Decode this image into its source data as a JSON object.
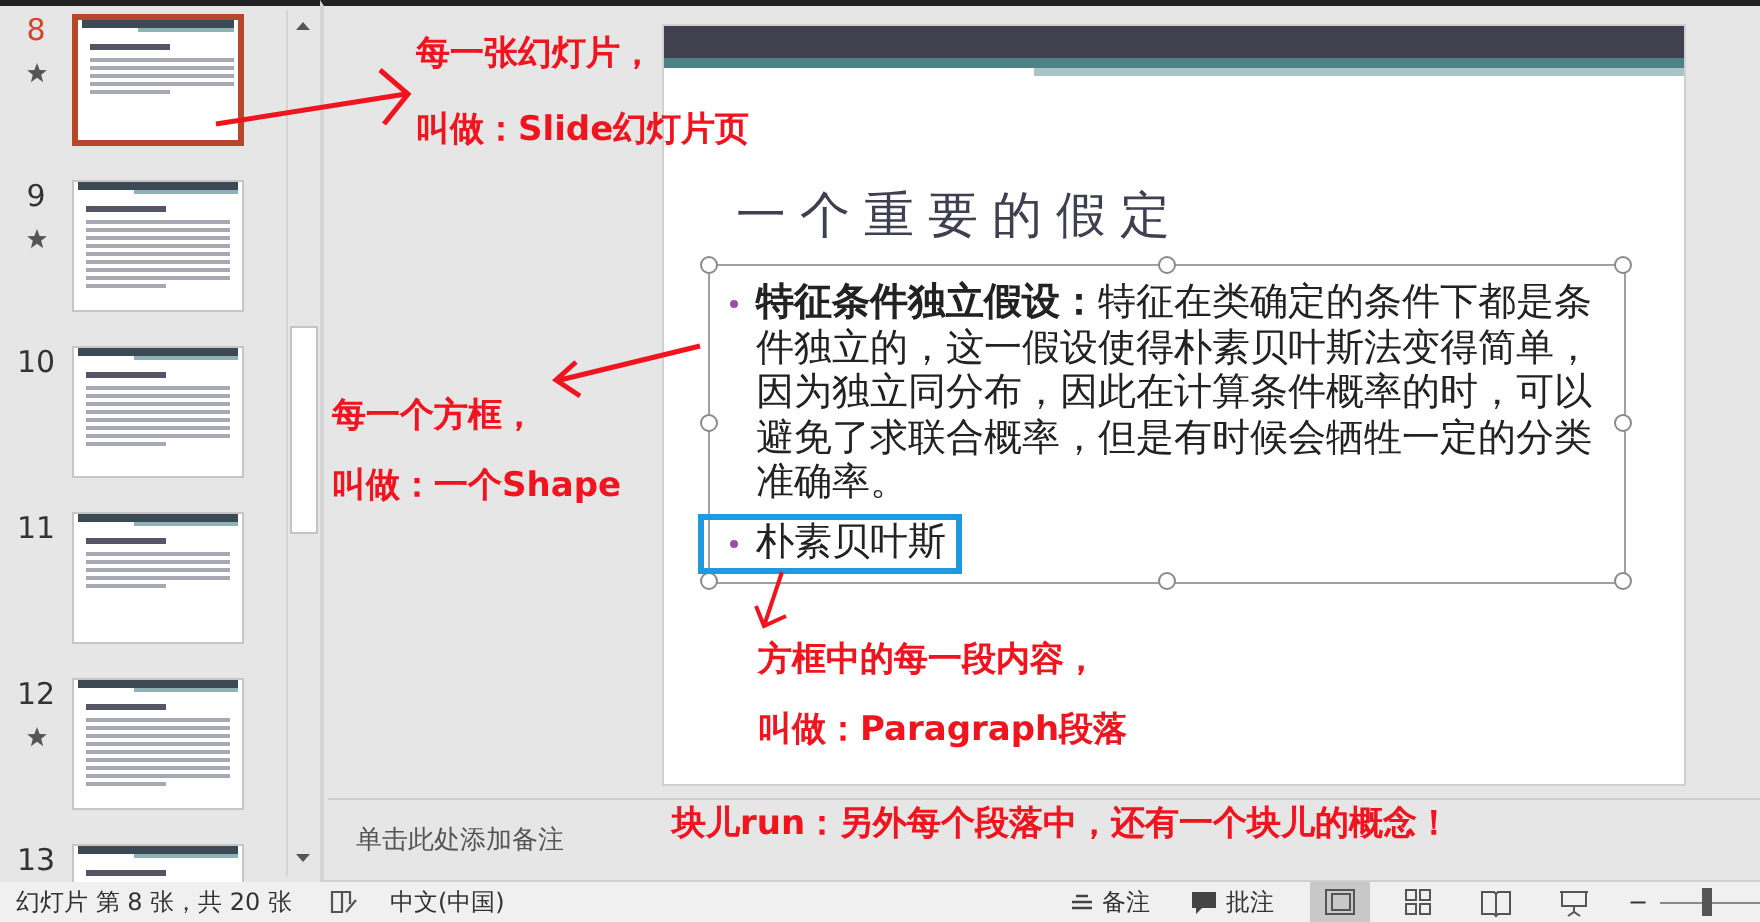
{
  "thumbnails": [
    {
      "number": "8",
      "selected": true,
      "starred": true
    },
    {
      "number": "9",
      "selected": false,
      "starred": true
    },
    {
      "number": "10",
      "selected": false,
      "starred": false
    },
    {
      "number": "11",
      "selected": false,
      "starred": false
    },
    {
      "number": "12",
      "selected": false,
      "starred": true
    },
    {
      "number": "13",
      "selected": false,
      "starred": false
    }
  ],
  "slide": {
    "title": "一个重要的假定",
    "paragraphs": [
      {
        "text": "**特征条件独立假设：**特征在类确定的条件下都是条件独立的，这一假设使得朴素贝叶斯法变得简单，因为独立同分布，因此在计算条件概率的时，可以避免了求联合概率，但是有时候会牺牲一定的分类准确率。",
        "highlighted": false
      },
      {
        "text": "朴素贝叶斯",
        "highlighted": true
      }
    ]
  },
  "notes": {
    "placeholder": "单击此处添加备注"
  },
  "annotations": [
    {
      "text": "每一张幻灯片，"
    },
    {
      "text": "叫做：Slide幻灯片页"
    },
    {
      "text": "每一个方框，"
    },
    {
      "text": "叫做：一个Shape"
    },
    {
      "text": "方框中的每一段内容，"
    },
    {
      "text": "叫做：Paragraph段落"
    },
    {
      "text": "块儿run：另外每个段落中，还有一个块儿的概念！"
    }
  ],
  "status_bar": {
    "slide_info": "幻灯片 第 8 张，共 20 张",
    "language": "中文(中国)",
    "notes_button": "备注",
    "comments_button": "批注",
    "views": [
      {
        "kind": "normal",
        "selected": true
      },
      {
        "kind": "sorter",
        "selected": false
      },
      {
        "kind": "reading",
        "selected": false
      },
      {
        "kind": "slideshow",
        "selected": false
      }
    ],
    "zoom_out": "−",
    "zoom": {
      "level": 0.45
    }
  }
}
